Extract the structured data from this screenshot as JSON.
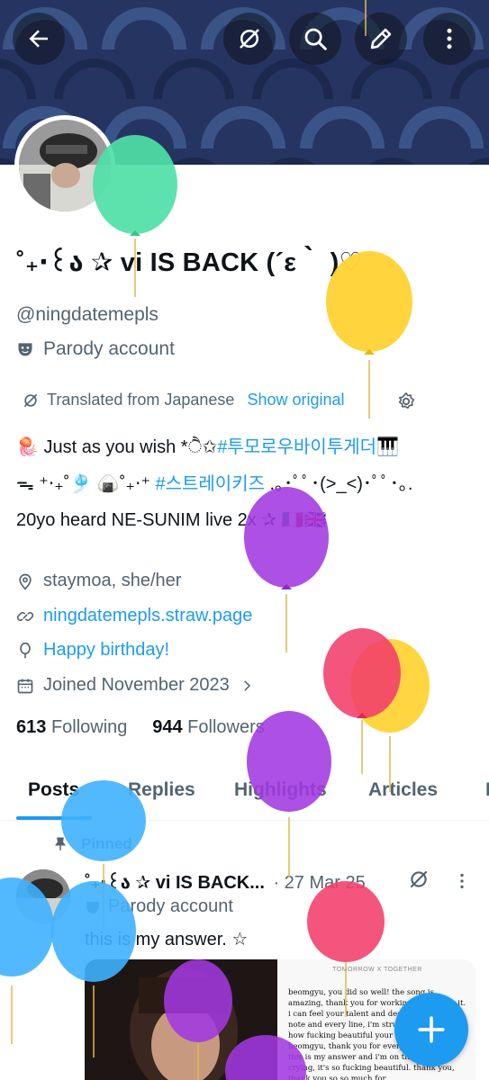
{
  "profile": {
    "display_name": "˚₊‧꒰ა ✰ vi IS BACK (´ε｀ )♡",
    "handle": "@ningdatemepls",
    "parody_label": "Parody account"
  },
  "translation": {
    "label": "Translated from Japanese",
    "show_original": "Show original"
  },
  "bio": {
    "line1_prefix": "🪼 Just as you wish *ੈ✩",
    "line1_tag": "#투모로우바이투게더🎹",
    "line2_prefix": "ᯓ ⁺‧₊˚🎐 🍙˚₊‧⁺",
    "line2_tag": "#스트레이키즈",
    "line2_suffix": " .｡･ﾟﾟ･(>_<)･ﾟﾟ･｡.",
    "line3": "20yo heard NE-SUNIM live 2x ✰ 🇮🇹🇬🇧"
  },
  "meta": {
    "location": "staymoa, she/her",
    "website": "ningdatemepls.straw.page",
    "birthday": "Happy birthday!",
    "joined": "Joined November 2023"
  },
  "stats": {
    "following_count": "613",
    "following_label": "Following",
    "followers_count": "944",
    "followers_label": "Followers"
  },
  "tabs": [
    {
      "label": "Posts"
    },
    {
      "label": "Replies"
    },
    {
      "label": "Highlights"
    },
    {
      "label": "Articles"
    },
    {
      "label": "M"
    }
  ],
  "pinned_post": {
    "pinned_label": "Pinned",
    "author": "˚₊‧꒰ა ✰ vi IS BACK...",
    "date": "· 27 Mar 25",
    "parody_label": "Parody account",
    "text": "this is my answer. ☆",
    "media_header": "TOMORROW X TOGETHER",
    "media_text": "beomgyu, you did so well! the song is amazing, thank you for working so hard on it. i can feel your talent and dedication in every note and every line, i'm struggling to write how fucking beautiful your work is. always, beomgyu, thank you for everything you do ♡ this is my answer and i'm on the verge of crying, it's so fucking beautiful. thank you, thank you so so much for"
  },
  "colors": {
    "accent": "#1d9bf0",
    "banner": "#24305a",
    "text_primary": "#0f1419",
    "text_secondary": "#536471"
  },
  "icons": {
    "back": "arrow-left-icon",
    "grok": "grok-icon",
    "search": "search-icon",
    "edit": "pencil-icon",
    "more": "more-vertical-icon",
    "fab": "plus-icon"
  }
}
